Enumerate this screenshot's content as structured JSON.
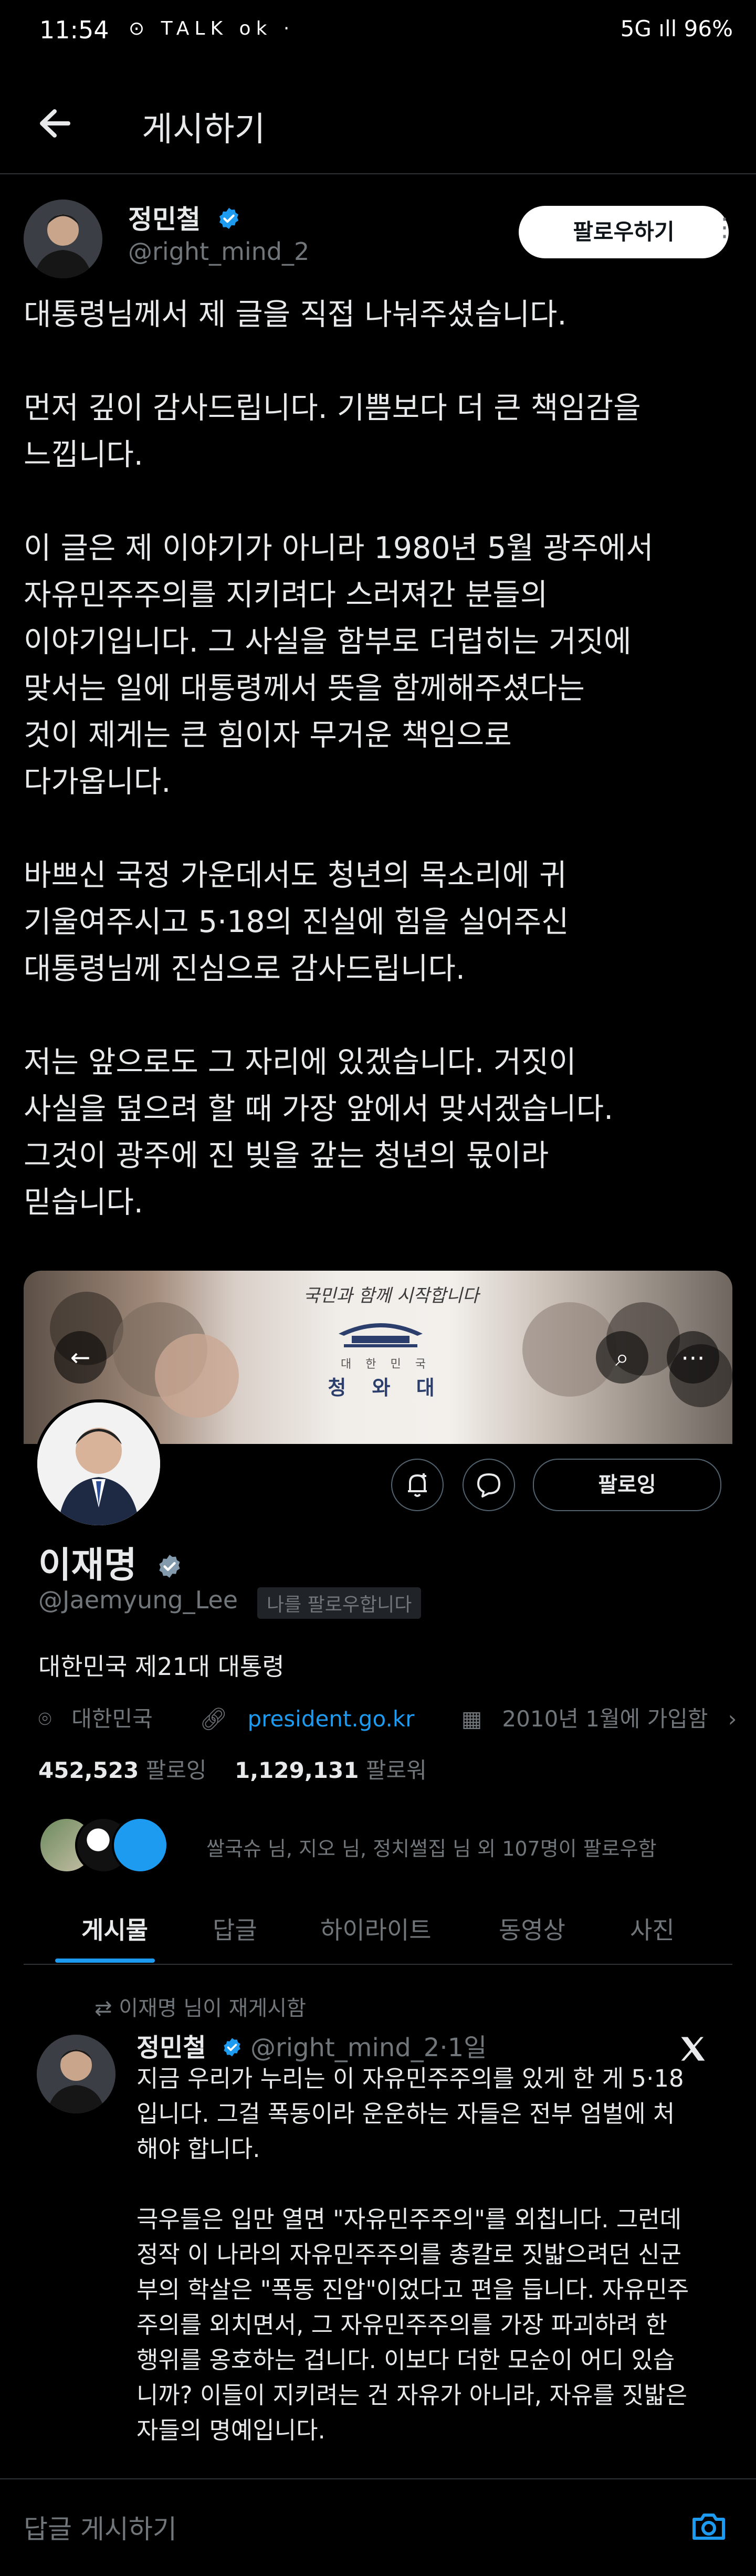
{
  "status_bar": {
    "time": "11:54",
    "left_icons": "⊙ TALK ok ·",
    "right_text": "5G ıll 96%"
  },
  "header": {
    "title": "게시하기"
  },
  "post": {
    "author_name": "정민철",
    "author_handle": "@right_mind_2",
    "follow_label": "팔로우하기",
    "paragraphs": [
      "대통령님께서 제 글을 직접 나눠주셨습니다.",
      "먼저 깊이 감사드립니다. 기쁨보다 더 큰 책임감을\n느낍니다.",
      "이 글은 제 이야기가 아니라 1980년 5월 광주에서\n자유민주주의를 지키려다 스러져간 분들의\n이야기입니다. 그 사실을 함부로 더럽히는 거짓에\n맞서는 일에 대통령께서 뜻을 함께해주셨다는\n것이 제게는 큰 힘이자 무거운 책임으로\n다가옵니다.",
      "바쁘신 국정 가운데서도 청년의 목소리에 귀\n기울여주시고 5·18의 진실에 힘을 실어주신\n대통령님께 진심으로 감사드립니다.",
      "저는 앞으로도 그 자리에 있겠습니다. 거짓이\n사실을 덮으려 할 때 가장 앞에서 맞서겠습니다.\n그것이 광주에 진 빚을 갚는 청년의 몫이라\n믿습니다."
    ]
  },
  "profile_card": {
    "banner_slogan": "국민과 함께 시작합니다",
    "banner_sub": "대 한 민 국",
    "banner_main": "청 와 대",
    "name": "이재명",
    "handle": "@Jaemyung_Lee",
    "follows_you": "나를 팔로우합니다",
    "following_label": "팔로잉",
    "bio": "대한민국 제21대 대통령",
    "location": "대한민국",
    "website": "president.go.kr",
    "joined": "2010년 1월에 가입함",
    "following_count": "452,523",
    "following_label_text": "팔로잉",
    "followers_count": "1,129,131",
    "followers_label_text": "팔로워",
    "known_followers": "쌀국슈 님, 지오 님, 정치썰집 님 외 107명이 팔로우함",
    "tabs": [
      "게시물",
      "답글",
      "하이라이트",
      "동영상",
      "사진"
    ]
  },
  "repost": {
    "repost_note": "이재명 님이 재게시함",
    "author_name": "정민철",
    "author_handle": "@right_mind_2",
    "time": "1일",
    "paragraphs": [
      "지금 우리가 누리는 이 자유민주주의를 있게 한 게 5·18\n입니다. 그걸 폭동이라 운운하는 자들은 전부 엄벌에 처\n해야 합니다.",
      "극우들은 입만 열면 \"자유민주주의\"를 외칩니다. 그런데\n정작 이 나라의 자유민주주의를 총칼로 짓밟으려던 신군\n부의 학살은 \"폭동 진압\"이었다고 편을 듭니다. 자유민주\n주의를 외치면서, 그 자유민주주의를 가장 파괴하려 한\n행위를 옹호하는 겁니다. 이보다 더한 모순이 어디 있습\n니까? 이들이 지키려는 건 자유가 아니라, 자유를 짓밟은\n자들의 명예입니다."
    ]
  },
  "reply_bar": {
    "placeholder": "답글 게시하기"
  },
  "colors": {
    "accent": "#1d9bf0",
    "background": "#000000",
    "text_primary": "#e7e9ea",
    "text_secondary": "#71767b",
    "border": "#2f3336"
  }
}
